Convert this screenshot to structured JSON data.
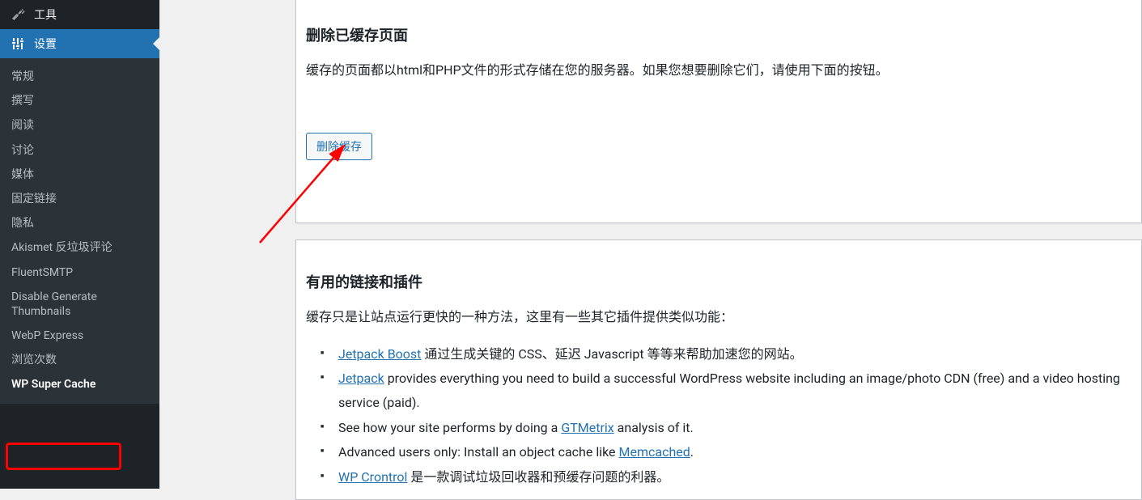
{
  "sidebar": {
    "tools_label": "工具",
    "settings_label": "设置",
    "submenu": [
      {
        "label": "常规"
      },
      {
        "label": "撰写"
      },
      {
        "label": "阅读"
      },
      {
        "label": "讨论"
      },
      {
        "label": "媒体"
      },
      {
        "label": "固定链接"
      },
      {
        "label": "隐私"
      },
      {
        "label": "Akismet 反垃圾评论"
      },
      {
        "label": "FluentSMTP"
      },
      {
        "label": "Disable Generate Thumbnails"
      },
      {
        "label": "WebP Express"
      },
      {
        "label": "浏览次数"
      },
      {
        "label": "WP Super Cache"
      }
    ]
  },
  "section1": {
    "title": "删除已缓存页面",
    "desc": "缓存的页面都以html和PHP文件的形式存储在您的服务器。如果您想要删除它们，请使用下面的按钮。",
    "button": "删除缓存"
  },
  "section2": {
    "title": "有用的链接和插件",
    "desc": "缓存只是让站点运行更快的一种方法，这里有一些其它插件提供类似功能：",
    "items": {
      "i0_link": "Jetpack Boost",
      "i0_tail": " 通过生成关键的 CSS、延迟 Javascript 等等来帮助加速您的网站。",
      "i1_link": "Jetpack",
      "i1_tail": " provides everything you need to build a successful WordPress website including an image/photo CDN (free) and a video hosting service (paid).",
      "i2_pre": "See how your site performs by doing a ",
      "i2_link": "GTMetrix",
      "i2_tail": " analysis of it.",
      "i3_pre": "Advanced users only: Install an object cache like ",
      "i3_link": "Memcached",
      "i3_tail": ".",
      "i4_link": "WP Crontrol",
      "i4_tail": " 是一款调试垃圾回收器和预缓存问题的利器。"
    }
  },
  "colors": {
    "accent": "#2271b1",
    "highlight": "#ff0000"
  }
}
